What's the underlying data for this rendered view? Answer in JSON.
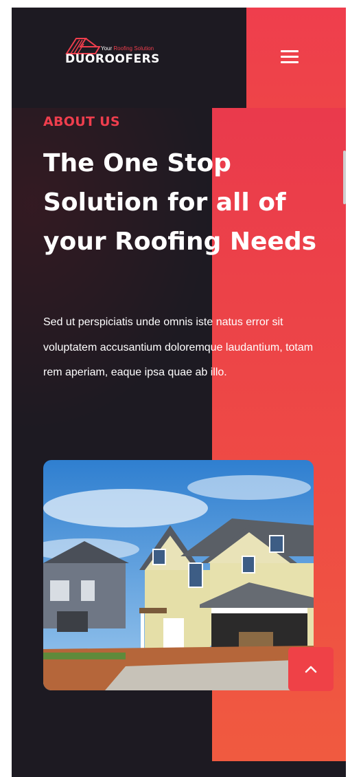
{
  "header": {
    "logo": {
      "tagline_prefix": "Your",
      "tagline_accent": "Roofing Solution",
      "brand": "DUOROOFERS"
    },
    "menu_icon": "hamburger-menu-icon"
  },
  "about": {
    "eyebrow": "ABOUT US",
    "headline": "The One Stop Solution for all of your Roofing Needs",
    "body": "Sed ut perspiciatis unde omnis iste natus error sit voluptatem accusantium doloremque laudantium, totam rem aperiam, eaque ipsa quae ab illo."
  },
  "back_to_top_icon": "chevron-up-icon",
  "colors": {
    "accent": "#ef3e4d",
    "dark_background": "#1d1a22",
    "text": "#ffffff"
  }
}
